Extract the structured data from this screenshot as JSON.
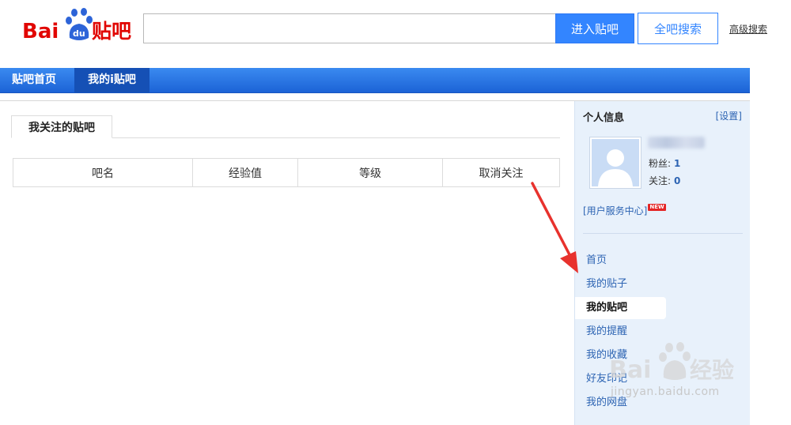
{
  "header": {
    "logo_text": "Bai du 贴吧",
    "search_placeholder": "",
    "enter_button": "进入贴吧",
    "all_search_button": "全吧搜索",
    "advanced_search": "高级搜索"
  },
  "nav": {
    "items": [
      {
        "label": "贴吧首页"
      },
      {
        "label": "我的i贴吧"
      }
    ]
  },
  "main": {
    "tab_label": "我关注的贴吧",
    "table": {
      "columns": [
        "吧名",
        "经验值",
        "等级",
        "取消关注"
      ]
    }
  },
  "sidebar": {
    "title": "个人信息",
    "settings": "[设置]",
    "fans_label": "粉丝:",
    "fans_count": "1",
    "follow_label": "关注:",
    "follow_count": "0",
    "service_center": "[用户服务中心]",
    "new_badge": "NEW",
    "menu": [
      {
        "label": "首页"
      },
      {
        "label": "我的贴子"
      },
      {
        "label": "我的贴吧"
      },
      {
        "label": "我的提醒"
      },
      {
        "label": "我的收藏"
      },
      {
        "label": "好友印记"
      },
      {
        "label": "我的网盘"
      }
    ],
    "active_index": 2
  },
  "watermark": {
    "text": "jingyan.baidu.com",
    "brand": "Bai du 经验"
  },
  "colors": {
    "accent": "#3385ff",
    "nav_bar": "#2a74e6",
    "nav_active": "#1550b5",
    "sidebar_bg": "#e8f1fb",
    "link": "#2d64b3",
    "arrow": "#e8322d"
  }
}
